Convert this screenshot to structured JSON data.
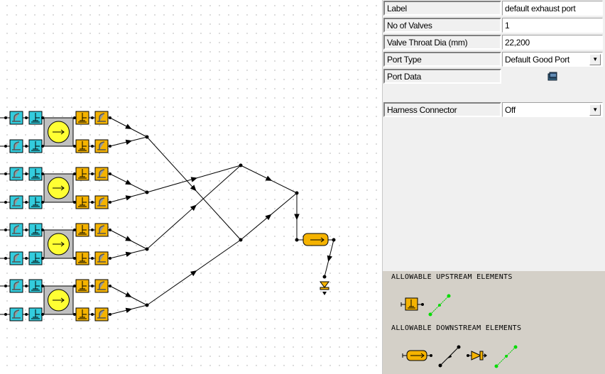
{
  "properties": [
    {
      "label": "Label",
      "value": "default exhaust port",
      "type": "text"
    },
    {
      "label": "No of Valves",
      "value": "1",
      "type": "text"
    },
    {
      "label": "Valve Throat Dia (mm)",
      "value": "22,200",
      "type": "text"
    },
    {
      "label": "Port Type",
      "value": "Default Good Port",
      "type": "select"
    },
    {
      "label": "Port Data",
      "icon": "notebook-icon",
      "type": "button"
    },
    {
      "label": "Harness Connector",
      "value": "Off",
      "type": "select"
    }
  ],
  "allowable": {
    "upstream_title": "ALLOWABLE UPSTREAM ELEMENTS",
    "downstream_title": "ALLOWABLE DOWNSTREAM ELEMENTS",
    "upstream": [
      "exhaust-port-icon",
      "green-connector-icon"
    ],
    "downstream": [
      "plenum-icon",
      "pipe-icon",
      "exhaust-end-icon",
      "green-connector-icon"
    ]
  },
  "colors": {
    "intake": "#33ccdd",
    "exhaust": "#f5b300",
    "cylinder": "#c0c0c0",
    "piston": "#ffff33",
    "connector": "#00dd00",
    "panel_bottom": "#d4d0c8"
  }
}
